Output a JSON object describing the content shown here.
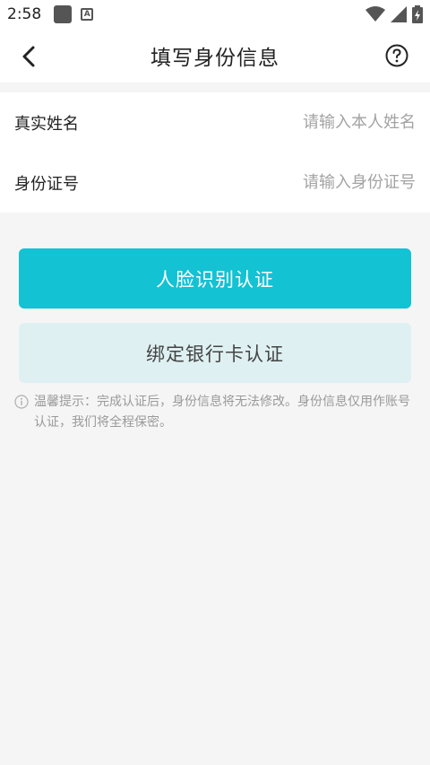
{
  "status_bar": {
    "time": "2:58"
  },
  "header": {
    "title": "填写身份信息"
  },
  "form": {
    "name_label": "真实姓名",
    "name_placeholder": "请输入本人姓名",
    "id_label": "身份证号",
    "id_placeholder": "请输入身份证号"
  },
  "buttons": {
    "face_verify": "人脸识别认证",
    "bank_verify": "绑定银行卡认证"
  },
  "tip": {
    "text": "温馨提示：完成认证后，身份信息将无法修改。身份信息仅用作账号认证，我们将全程保密。"
  },
  "colors": {
    "accent": "#13c2d3",
    "secondary_bg": "#dff0f2",
    "page_bg": "#f5f5f5"
  }
}
